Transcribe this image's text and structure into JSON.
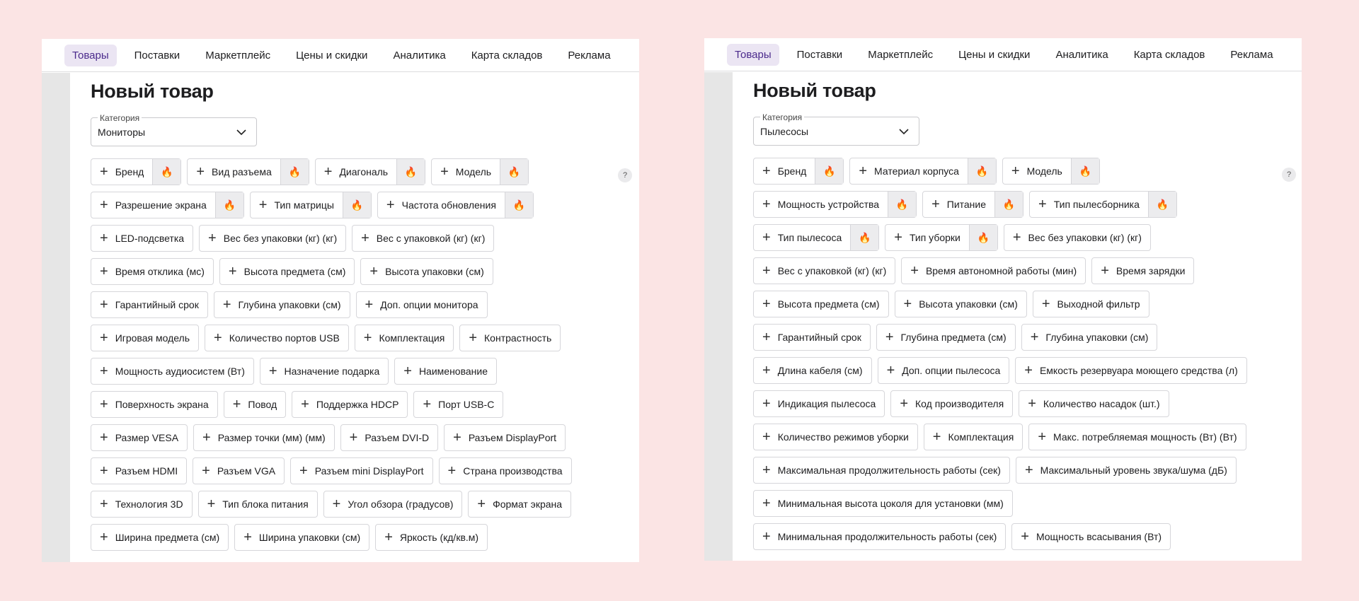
{
  "nav": [
    "Товары",
    "Поставки",
    "Маркетплейс",
    "Цены и скидки",
    "Аналитика",
    "Карта складов",
    "Реклама"
  ],
  "page_title": "Новый товар",
  "category_label": "Категория",
  "help_label": "?",
  "fire_icon": "🔥",
  "plus_icon": "+",
  "left": {
    "category_value": "Мониторы",
    "chips": [
      {
        "label": "Бренд",
        "hot": true
      },
      {
        "label": "Вид разъема",
        "hot": true
      },
      {
        "label": "Диагональ",
        "hot": true
      },
      {
        "label": "Модель",
        "hot": true
      },
      {
        "label": "Разрешение экрана",
        "hot": true
      },
      {
        "label": "Тип матрицы",
        "hot": true
      },
      {
        "label": "Частота обновления",
        "hot": true
      },
      {
        "label": "LED-подсветка",
        "hot": false
      },
      {
        "label": "Вес без упаковки (кг) (кг)",
        "hot": false
      },
      {
        "label": "Вес с упаковкой (кг) (кг)",
        "hot": false
      },
      {
        "label": "Время отклика (мс)",
        "hot": false
      },
      {
        "label": "Высота предмета (см)",
        "hot": false
      },
      {
        "label": "Высота упаковки (см)",
        "hot": false
      },
      {
        "label": "Гарантийный срок",
        "hot": false
      },
      {
        "label": "Глубина упаковки (см)",
        "hot": false
      },
      {
        "label": "Доп. опции монитора",
        "hot": false
      },
      {
        "label": "Игровая модель",
        "hot": false
      },
      {
        "label": "Количество портов USB",
        "hot": false
      },
      {
        "label": "Комплектация",
        "hot": false
      },
      {
        "label": "Контрастность",
        "hot": false
      },
      {
        "label": "Мощность аудиосистем (Вт)",
        "hot": false
      },
      {
        "label": "Назначение подарка",
        "hot": false
      },
      {
        "label": "Наименование",
        "hot": false
      },
      {
        "label": "Поверхность экрана",
        "hot": false
      },
      {
        "label": "Повод",
        "hot": false
      },
      {
        "label": "Поддержка HDCP",
        "hot": false
      },
      {
        "label": "Порт USB-C",
        "hot": false
      },
      {
        "label": "Размер VESA",
        "hot": false
      },
      {
        "label": "Размер точки (мм) (мм)",
        "hot": false
      },
      {
        "label": "Разъем DVI-D",
        "hot": false
      },
      {
        "label": "Разъем DisplayPort",
        "hot": false
      },
      {
        "label": "Разъем HDMI",
        "hot": false
      },
      {
        "label": "Разъем VGA",
        "hot": false
      },
      {
        "label": "Разъем mini DisplayPort",
        "hot": false
      },
      {
        "label": "Страна производства",
        "hot": false
      },
      {
        "label": "Технология 3D",
        "hot": false
      },
      {
        "label": "Тип блока питания",
        "hot": false
      },
      {
        "label": "Угол обзора (градусов)",
        "hot": false
      },
      {
        "label": "Формат экрана",
        "hot": false
      },
      {
        "label": "Ширина предмета (см)",
        "hot": false
      },
      {
        "label": "Ширина упаковки (см)",
        "hot": false
      },
      {
        "label": "Яркость (кд/кв.м)",
        "hot": false
      }
    ]
  },
  "right": {
    "category_value": "Пылесосы",
    "chips": [
      {
        "label": "Бренд",
        "hot": true
      },
      {
        "label": "Материал корпуса",
        "hot": true
      },
      {
        "label": "Модель",
        "hot": true
      },
      {
        "label": "Мощность устройства",
        "hot": true
      },
      {
        "label": "Питание",
        "hot": true
      },
      {
        "label": "Тип пылесборника",
        "hot": true
      },
      {
        "label": "Тип пылесоса",
        "hot": true
      },
      {
        "label": "Тип уборки",
        "hot": true
      },
      {
        "label": "Вес без упаковки (кг) (кг)",
        "hot": false
      },
      {
        "label": "Вес с упаковкой (кг) (кг)",
        "hot": false
      },
      {
        "label": "Время автономной работы (мин)",
        "hot": false
      },
      {
        "label": "Время зарядки",
        "hot": false
      },
      {
        "label": "Высота предмета (см)",
        "hot": false
      },
      {
        "label": "Высота упаковки (см)",
        "hot": false
      },
      {
        "label": "Выходной фильтр",
        "hot": false
      },
      {
        "label": "Гарантийный срок",
        "hot": false
      },
      {
        "label": "Глубина предмета (см)",
        "hot": false
      },
      {
        "label": "Глубина упаковки (см)",
        "hot": false
      },
      {
        "label": "Длина кабеля (см)",
        "hot": false
      },
      {
        "label": "Доп. опции пылесоса",
        "hot": false
      },
      {
        "label": "Емкость резервуара моющего средства (л)",
        "hot": false
      },
      {
        "label": "Индикация пылесоса",
        "hot": false
      },
      {
        "label": "Код производителя",
        "hot": false
      },
      {
        "label": "Количество насадок (шт.)",
        "hot": false
      },
      {
        "label": "Количество режимов уборки",
        "hot": false
      },
      {
        "label": "Комплектация",
        "hot": false
      },
      {
        "label": "Макс. потребляемая мощность (Вт) (Вт)",
        "hot": false
      },
      {
        "label": "Максимальная продолжительность работы (сек)",
        "hot": false
      },
      {
        "label": "Максимальный уровень звука/шума (дБ)",
        "hot": false
      },
      {
        "label": "Минимальная высота цоколя для установки (мм)",
        "hot": false
      },
      {
        "label": "Минимальная продолжительность работы (сек)",
        "hot": false
      },
      {
        "label": "Мощность всасывания (Вт)",
        "hot": false
      }
    ]
  }
}
